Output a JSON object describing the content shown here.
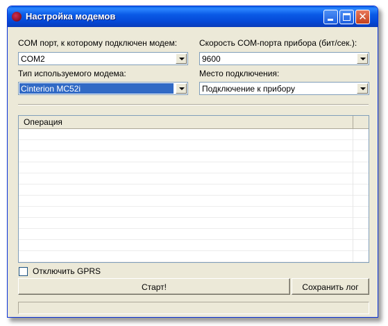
{
  "window": {
    "title": "Настройка модемов"
  },
  "com_port": {
    "label": "COM порт, к которому подключен модем:",
    "value": "COM2"
  },
  "baud_rate": {
    "label": "Скорость COM-порта прибора (бит/сек.):",
    "value": "9600"
  },
  "modem_type": {
    "label": "Тип используемого модема:",
    "value": "Cinterion MC52i"
  },
  "connection_place": {
    "label": "Место подключения:",
    "value": "Подключение к прибору"
  },
  "operations_list": {
    "columns": [
      "Операция",
      ""
    ]
  },
  "gprs": {
    "label": "Отключить GPRS",
    "checked": false
  },
  "buttons": {
    "start": "Старт!",
    "save_log": "Сохранить лог"
  },
  "icons": {
    "app": "app-icon",
    "minimize": "minimize-icon",
    "maximize": "maximize-icon",
    "close": "close-icon",
    "dropdown": "chevron-down-icon"
  },
  "colors": {
    "titlebar": "#0a5ae6",
    "close_button": "#c5401c",
    "selection": "#316ac5",
    "window_bg": "#ece9d8"
  }
}
